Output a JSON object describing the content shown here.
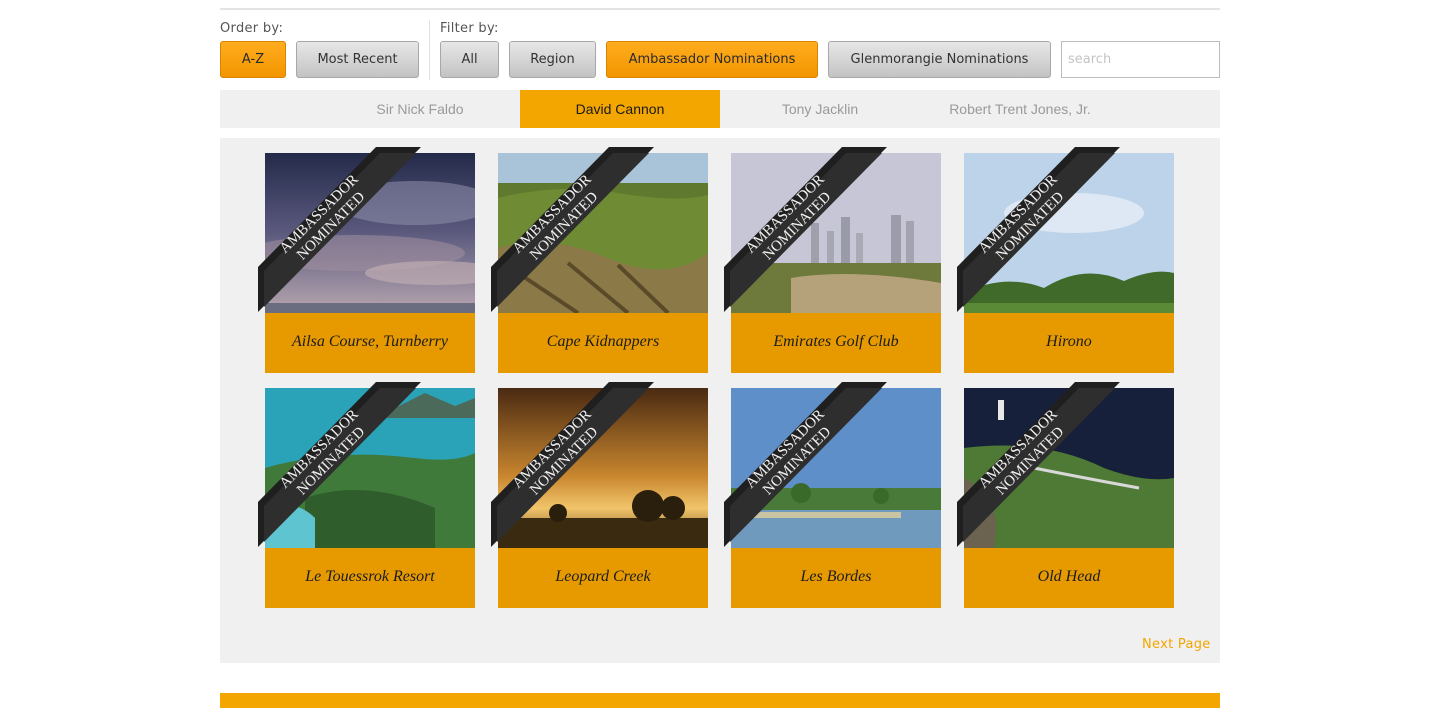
{
  "toolbar": {
    "order_label": "Order by:",
    "filter_label": "Filter by:",
    "order_buttons": [
      "A-Z",
      "Most Recent"
    ],
    "filter_buttons": [
      "All",
      "Region",
      "Ambassador Nominations",
      "Glenmorangie Nominations"
    ],
    "search_placeholder": "search"
  },
  "tabs": [
    "Sir Nick Faldo",
    "David Cannon",
    "Tony Jacklin",
    "Robert Trent Jones, Jr."
  ],
  "ribbon": {
    "line1": "AMBASSADOR",
    "line2": "NOMINATED"
  },
  "courses": [
    "Ailsa Course, Turnberry",
    "Cape Kidnappers",
    "Emirates Golf Club",
    "Hirono",
    "Le Touessrok Resort",
    "Leopard Creek",
    "Les Bordes",
    "Old Head"
  ],
  "pagination": {
    "next_label": "Next Page"
  },
  "colors": {
    "accent": "#f3a600",
    "caption": "#e79a00",
    "panel": "#f0f0f0"
  }
}
